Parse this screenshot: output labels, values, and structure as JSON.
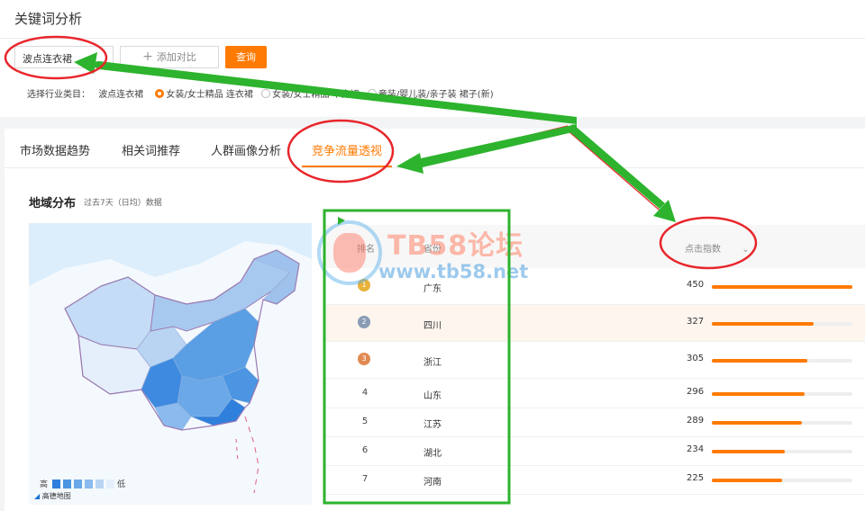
{
  "page_title": "关键词分析",
  "search": {
    "keyword_value": "波点连衣裙",
    "add_compare_label": "添加对比",
    "query_label": "查询"
  },
  "industry": {
    "label": "选择行业类目：",
    "keyword": "波点连衣裙",
    "options": [
      {
        "label": "女装/女士精品 连衣裙",
        "selected": true
      },
      {
        "label": "女装/女士精品 半身裙",
        "selected": false
      },
      {
        "label": "童装/婴儿装/亲子装 裙子(新)",
        "selected": false
      }
    ]
  },
  "tabs": [
    {
      "label": "市场数据趋势",
      "active": false
    },
    {
      "label": "相关词推荐",
      "active": false
    },
    {
      "label": "人群画像分析",
      "active": false
    },
    {
      "label": "竞争流量透视",
      "active": true
    }
  ],
  "region": {
    "title": "地域分布",
    "subtitle": "过去7天（日均）数据",
    "legend_high": "高",
    "legend_low": "低",
    "attribution": "高德地图"
  },
  "table": {
    "headers": {
      "rank": "排名",
      "province": "省份",
      "clicks": "点击指数"
    },
    "rows": [
      {
        "rank": "1",
        "province": "广东",
        "value": 450,
        "medal": "gold"
      },
      {
        "rank": "2",
        "province": "四川",
        "value": 327,
        "medal": "silver"
      },
      {
        "rank": "3",
        "province": "浙江",
        "value": 305,
        "medal": "bronze"
      },
      {
        "rank": "4",
        "province": "山东",
        "value": 296,
        "medal": ""
      },
      {
        "rank": "5",
        "province": "江苏",
        "value": 289,
        "medal": ""
      },
      {
        "rank": "6",
        "province": "湖北",
        "value": 234,
        "medal": ""
      },
      {
        "rank": "7",
        "province": "河南",
        "value": 225,
        "medal": ""
      }
    ]
  },
  "watermark": {
    "title": "TB58论坛",
    "url": "www.tb58.net"
  },
  "colors": {
    "accent": "#ff7a00",
    "annotation_red": "#e8262b",
    "annotation_green": "#2db32d"
  }
}
